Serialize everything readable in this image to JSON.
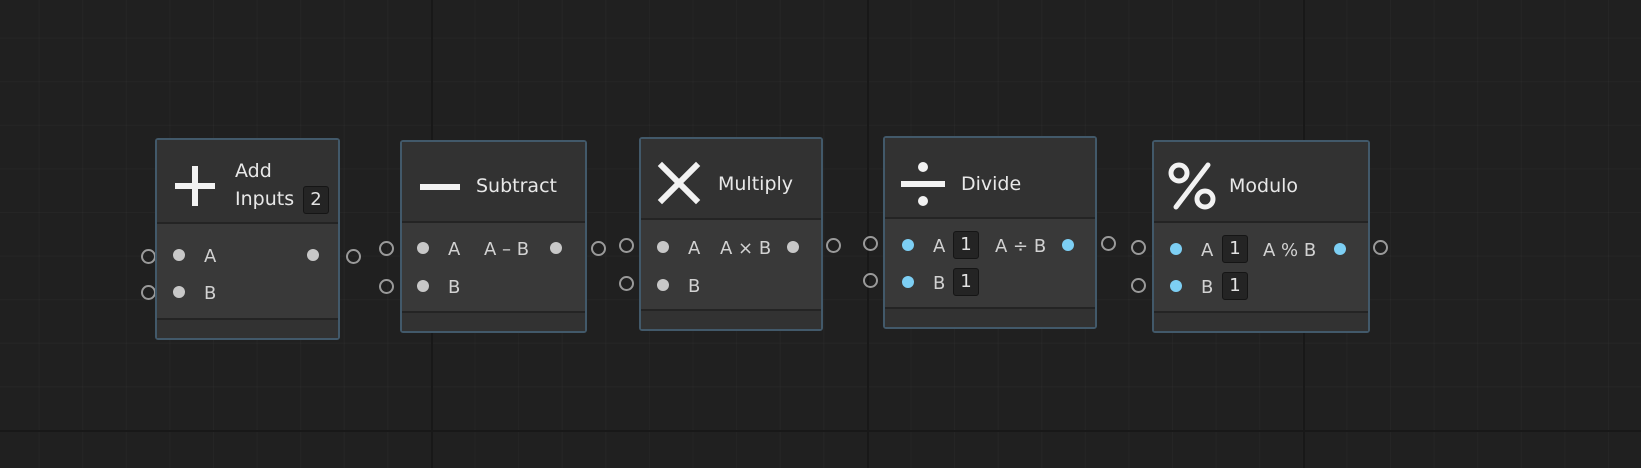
{
  "nodes": {
    "add": {
      "title_line1": "Add",
      "title_line2": "Inputs",
      "inputs_count": "2",
      "input_a": "A",
      "input_b": "B",
      "icon": "plus-icon"
    },
    "subtract": {
      "title": "Subtract",
      "input_a": "A",
      "input_b": "B",
      "output": "A – B",
      "icon": "minus-icon"
    },
    "multiply": {
      "title": "Multiply",
      "input_a": "A",
      "input_b": "B",
      "output": "A × B",
      "icon": "times-icon"
    },
    "divide": {
      "title": "Divide",
      "input_a": "A",
      "input_b": "B",
      "value_a": "1",
      "value_b": "1",
      "output": "A ÷ B",
      "icon": "divide-icon"
    },
    "modulo": {
      "title": "Modulo",
      "input_a": "A",
      "input_b": "B",
      "value_a": "1",
      "value_b": "1",
      "output": "A % B",
      "icon": "percent-icon"
    }
  },
  "colors": {
    "background": "#202020",
    "node_body": "#393939",
    "node_border": "#42596a",
    "float_port": "#c8c8c8",
    "vector_port": "#7dcff4"
  }
}
